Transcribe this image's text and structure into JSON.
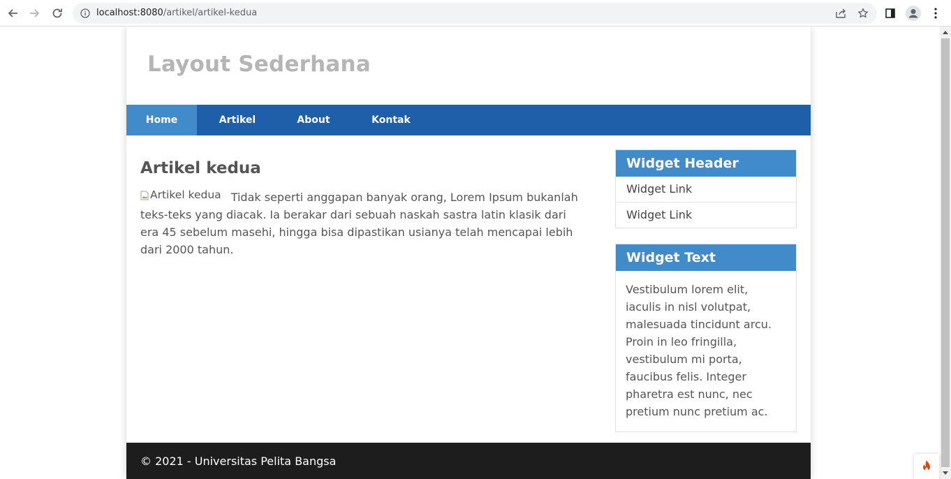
{
  "browser": {
    "url_host": "localhost:8080",
    "url_path": "/artikel/artikel-kedua"
  },
  "site": {
    "title": "Layout Sederhana"
  },
  "nav": {
    "items": [
      {
        "label": "Home",
        "active": true
      },
      {
        "label": "Artikel",
        "active": false
      },
      {
        "label": "About",
        "active": false
      },
      {
        "label": "Kontak",
        "active": false
      }
    ]
  },
  "article": {
    "title": "Artikel kedua",
    "image_alt": "Artikel kedua",
    "body": "Tidak seperti anggapan banyak orang, Lorem Ipsum bukanlah teks-teks yang diacak. Ia berakar dari sebuah naskah sastra latin klasik dari era 45 sebelum masehi, hingga bisa dipastikan usianya telah mencapai lebih dari 2000 tahun."
  },
  "sidebar": {
    "widget_links": {
      "header": "Widget Header",
      "links": [
        "Widget Link",
        "Widget Link"
      ]
    },
    "widget_text": {
      "header": "Widget Text",
      "text": "Vestibulum lorem elit, iaculis in nisl volutpat, malesuada tincidunt arcu. Proin in leo fringilla, vestibulum mi porta, faucibus felis. Integer pharetra est nunc, nec pretium nunc pretium ac."
    }
  },
  "footer": {
    "text": "© 2021 - Universitas Pelita Bangsa"
  },
  "colors": {
    "nav_bg": "#1f5faa",
    "nav_active": "#428bca",
    "widget_header": "#428bca",
    "footer_bg": "#1d1d1d",
    "title_color": "#b5b5b5"
  }
}
